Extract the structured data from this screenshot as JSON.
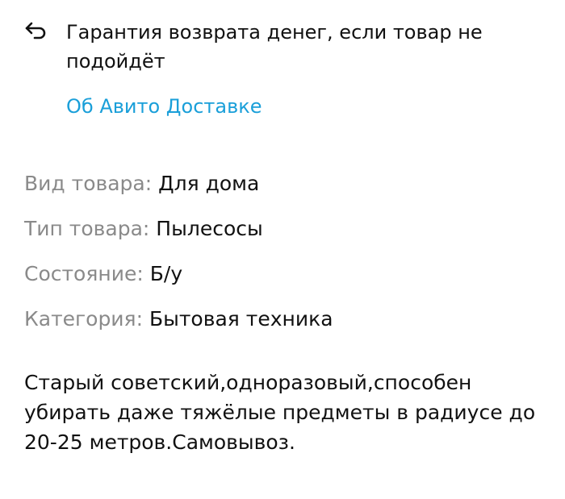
{
  "guarantee": {
    "icon": "return-arrow-icon",
    "text": "Гарантия возврата денег, если товар не подойдёт"
  },
  "delivery_link": {
    "label": "Об Авито Доставке",
    "color": "#1a9fd9"
  },
  "params": [
    {
      "label": "Вид товара:",
      "value": "Для дома"
    },
    {
      "label": "Тип товара:",
      "value": "Пылесосы"
    },
    {
      "label": "Состояние:",
      "value": "Б/у"
    },
    {
      "label": "Категория:",
      "value": "Бытовая техника"
    }
  ],
  "description": "Старый советский,одноразовый,способен убирать даже тяжёлые предметы в радиусе до 20-25 метров.Самовывоз."
}
